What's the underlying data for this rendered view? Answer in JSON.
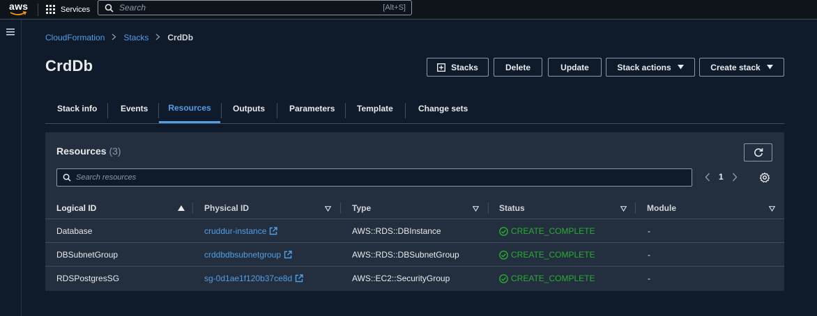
{
  "topbar": {
    "logo_text": "aws",
    "services_label": "Services",
    "search_placeholder": "Search",
    "search_shortcut": "[Alt+S]"
  },
  "breadcrumb": {
    "items": [
      "CloudFormation",
      "Stacks"
    ],
    "current": "CrdDb"
  },
  "page_title": "CrdDb",
  "header_buttons": {
    "stacks": "Stacks",
    "delete": "Delete",
    "update": "Update",
    "stack_actions": "Stack actions",
    "create_stack": "Create stack"
  },
  "tabs": [
    "Stack info",
    "Events",
    "Resources",
    "Outputs",
    "Parameters",
    "Template",
    "Change sets"
  ],
  "active_tab": "Resources",
  "resources": {
    "title": "Resources",
    "count": "(3)",
    "search_placeholder": "Search resources",
    "page_number": "1",
    "columns": [
      "Logical ID",
      "Physical ID",
      "Type",
      "Status",
      "Module"
    ],
    "rows": [
      {
        "logical_id": "Database",
        "physical_id": "cruddur-instance",
        "type": "AWS::RDS::DBInstance",
        "status": "CREATE_COMPLETE",
        "module": "-"
      },
      {
        "logical_id": "DBSubnetGroup",
        "physical_id": "crddbdbsubnetgroup",
        "type": "AWS::RDS::DBSubnetGroup",
        "status": "CREATE_COMPLETE",
        "module": "-"
      },
      {
        "logical_id": "RDSPostgresSG",
        "physical_id": "sg-0d1ae1f120b37ce8d",
        "type": "AWS::EC2::SecurityGroup",
        "status": "CREATE_COMPLETE",
        "module": "-"
      }
    ]
  },
  "colors": {
    "link": "#539fe5",
    "success": "#29ad32",
    "panel": "#232f3e",
    "background": "#0f1b2a"
  }
}
